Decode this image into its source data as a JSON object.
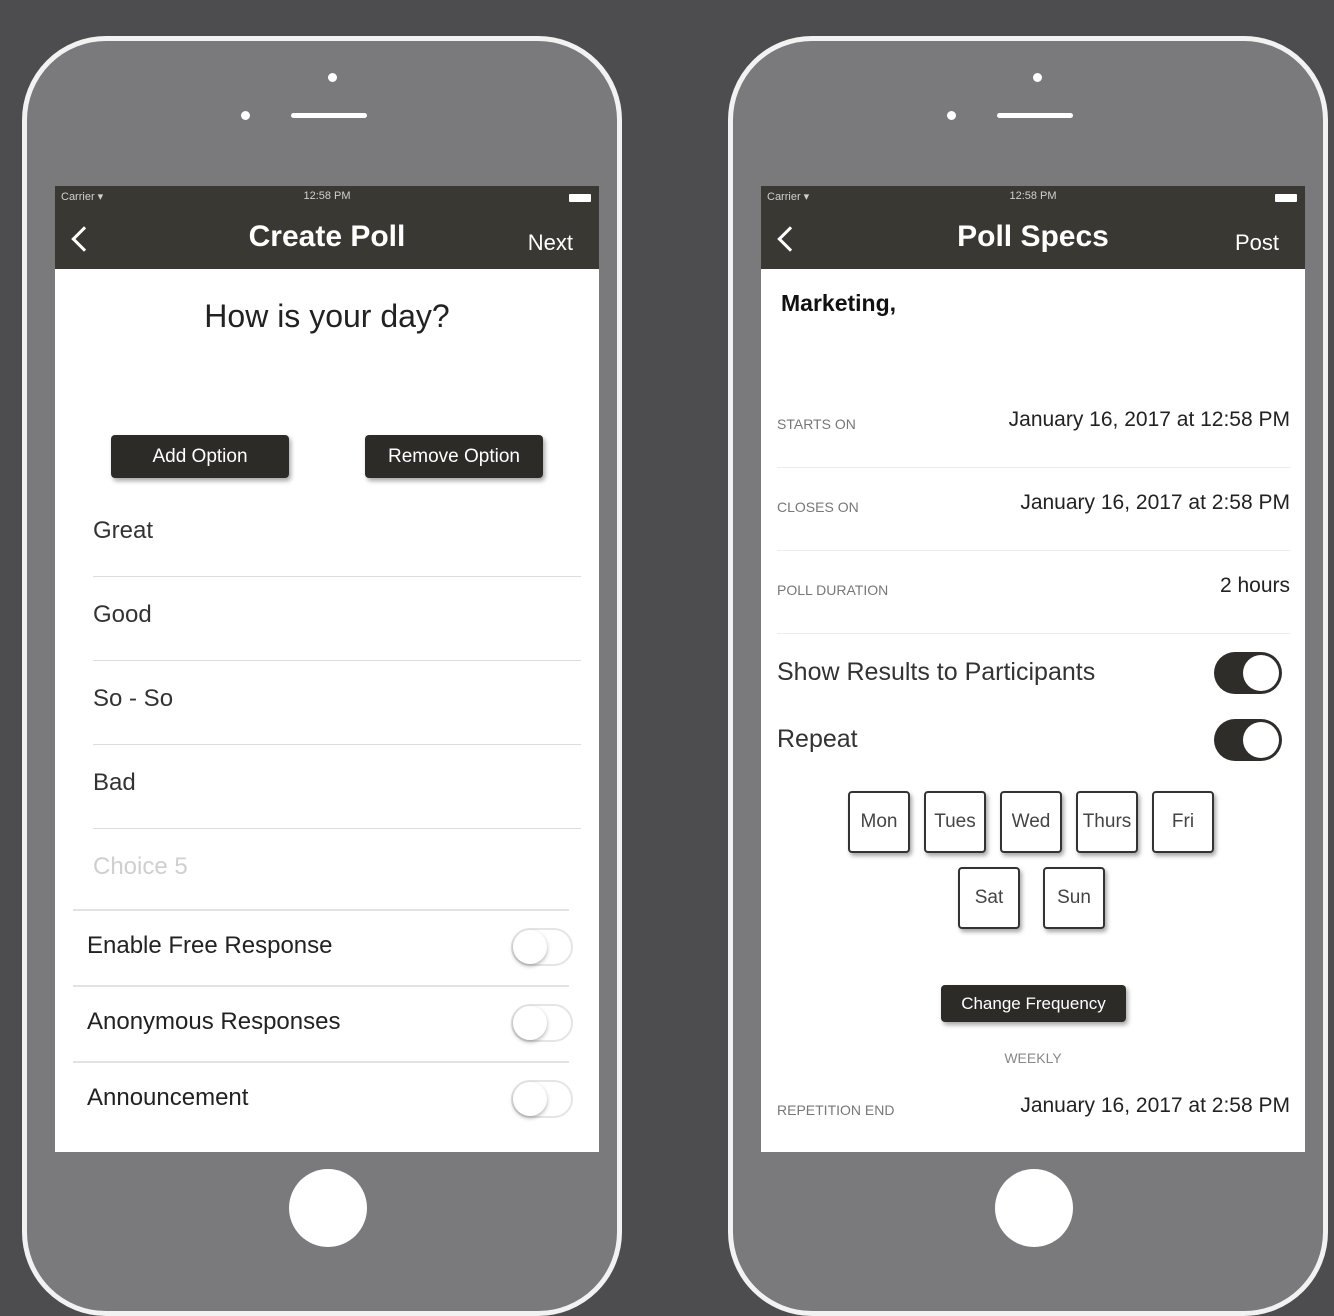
{
  "status_bar": {
    "carrier": "Carrier ▾",
    "time": "12:58 PM"
  },
  "create_poll": {
    "title": "Create Poll",
    "next_label": "Next",
    "question": "How is your day?",
    "add_option_label": "Add Option",
    "remove_option_label": "Remove Option",
    "options": [
      "Great",
      "Good",
      "So - So",
      "Bad"
    ],
    "choice_placeholder": "Choice 5",
    "toggles": [
      {
        "label": "Enable Free Response",
        "on": false
      },
      {
        "label": "Anonymous Responses",
        "on": false
      },
      {
        "label": "Announcement",
        "on": false
      }
    ]
  },
  "poll_specs": {
    "title": "Poll Specs",
    "post_label": "Post",
    "group": "Marketing,",
    "starts_on": {
      "label": "STARTS ON",
      "value": "January 16, 2017 at 12:58 PM"
    },
    "closes_on": {
      "label": "CLOSES ON",
      "value": "January 16, 2017 at 2:58 PM"
    },
    "duration": {
      "label": "POLL DURATION",
      "value": "2 hours"
    },
    "show_results": {
      "label": "Show Results to Participants",
      "on": true
    },
    "repeat": {
      "label": "Repeat",
      "on": true
    },
    "days": [
      "Mon",
      "Tues",
      "Wed",
      "Thurs",
      "Fri",
      "Sat",
      "Sun"
    ],
    "change_frequency_label": "Change Frequency",
    "frequency": "WEEKLY",
    "repetition_end": {
      "label": "REPETITION END",
      "value": "January 16, 2017 at 2:58 PM"
    }
  },
  "icons": [
    "back-chevron-icon",
    "wifi-icon",
    "battery-icon"
  ]
}
